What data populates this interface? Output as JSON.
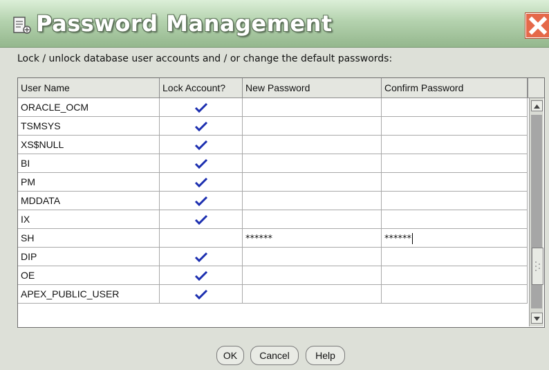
{
  "window": {
    "title": "Password Management",
    "close_icon": "close-icon",
    "title_icon": "database-key-icon"
  },
  "instruction": "Lock / unlock database user accounts and / or change the default passwords:",
  "table": {
    "columns": [
      "User Name",
      "Lock Account?",
      "New Password",
      "Confirm Password"
    ],
    "rows": [
      {
        "user": "ORACLE_OCM",
        "locked": true,
        "new_password": "",
        "confirm_password": ""
      },
      {
        "user": "TSMSYS",
        "locked": true,
        "new_password": "",
        "confirm_password": ""
      },
      {
        "user": "XS$NULL",
        "locked": true,
        "new_password": "",
        "confirm_password": ""
      },
      {
        "user": "BI",
        "locked": true,
        "new_password": "",
        "confirm_password": ""
      },
      {
        "user": "PM",
        "locked": true,
        "new_password": "",
        "confirm_password": ""
      },
      {
        "user": "MDDATA",
        "locked": true,
        "new_password": "",
        "confirm_password": ""
      },
      {
        "user": "IX",
        "locked": true,
        "new_password": "",
        "confirm_password": ""
      },
      {
        "user": "SH",
        "locked": false,
        "new_password": "******",
        "confirm_password": "******"
      },
      {
        "user": "DIP",
        "locked": true,
        "new_password": "",
        "confirm_password": ""
      },
      {
        "user": "OE",
        "locked": true,
        "new_password": "",
        "confirm_password": ""
      },
      {
        "user": "APEX_PUBLIC_USER",
        "locked": true,
        "new_password": "",
        "confirm_password": ""
      }
    ],
    "check_color": "#1c2fb0"
  },
  "buttons": {
    "ok": "OK",
    "cancel": "Cancel",
    "help": "Help"
  }
}
